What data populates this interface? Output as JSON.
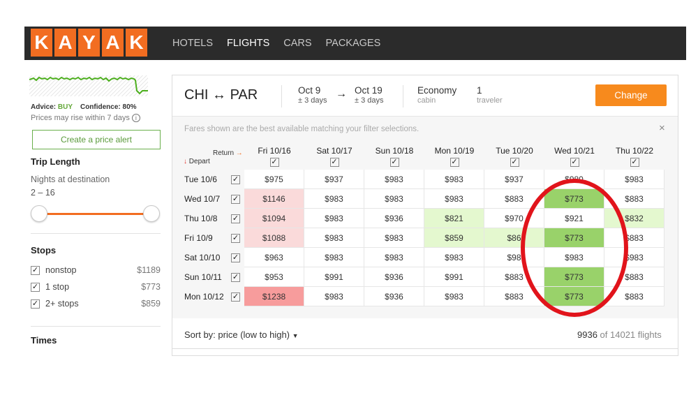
{
  "logo": [
    "K",
    "A",
    "Y",
    "A",
    "K"
  ],
  "nav": [
    {
      "label": "HOTELS",
      "active": false
    },
    {
      "label": "FLIGHTS",
      "active": true
    },
    {
      "label": "CARS",
      "active": false
    },
    {
      "label": "PACKAGES",
      "active": false
    }
  ],
  "sidebar": {
    "advice_label": "Advice:",
    "advice_value": "BUY",
    "confidence_label": "Confidence:",
    "confidence_value": "80%",
    "rise_text": "Prices may rise within 7 days",
    "alert_button": "Create a price alert",
    "trip_length_title": "Trip Length",
    "nights_label": "Nights at destination",
    "nights_range": "2 – 16",
    "stops_title": "Stops",
    "stops": [
      {
        "label": "nonstop",
        "price": "$1189",
        "checked": true
      },
      {
        "label": "1 stop",
        "price": "$773",
        "checked": true
      },
      {
        "label": "2+ stops",
        "price": "$859",
        "checked": true
      }
    ],
    "times_title": "Times"
  },
  "search": {
    "route_from": "CHI",
    "route_sym": "↔",
    "route_to": "PAR",
    "depart_date": "Oct 9",
    "depart_flex": "± 3 days",
    "return_date": "Oct 19",
    "return_flex": "± 3 days",
    "cabin": "Economy",
    "cabin_label": "cabin",
    "travelers": "1",
    "travelers_label": "traveler",
    "change_button": "Change"
  },
  "grid": {
    "notice": "Fares shown are the best available matching your filter selections.",
    "close": "×",
    "return_label": "Return",
    "depart_label": "Depart",
    "columns": [
      "Fri 10/16",
      "Sat 10/17",
      "Sun 10/18",
      "Mon 10/19",
      "Tue 10/20",
      "Wed 10/21",
      "Thu 10/22"
    ],
    "rows": [
      {
        "label": "Tue 10/6",
        "prices": [
          "$975",
          "$937",
          "$983",
          "$983",
          "$937",
          "$980",
          "$983"
        ],
        "shade": [
          "",
          "",
          "",
          "",
          "",
          "",
          ""
        ]
      },
      {
        "label": "Wed 10/7",
        "prices": [
          "$1146",
          "$983",
          "$983",
          "$983",
          "$883",
          "$773",
          "$883"
        ],
        "shade": [
          "lr",
          "",
          "",
          "",
          "",
          "g",
          ""
        ]
      },
      {
        "label": "Thu 10/8",
        "prices": [
          "$1094",
          "$983",
          "$936",
          "$821",
          "$970",
          "$921",
          "$832"
        ],
        "shade": [
          "lr",
          "",
          "",
          "lg",
          "",
          "",
          "lg"
        ]
      },
      {
        "label": "Fri 10/9",
        "prices": [
          "$1088",
          "$983",
          "$983",
          "$859",
          "$86",
          "$773",
          "$883"
        ],
        "shade": [
          "lr",
          "",
          "",
          "lg",
          "lg",
          "g",
          ""
        ]
      },
      {
        "label": "Sat 10/10",
        "prices": [
          "$963",
          "$983",
          "$983",
          "$983",
          "$98",
          "$983",
          "$983"
        ],
        "shade": [
          "",
          "",
          "",
          "",
          "",
          "",
          ""
        ]
      },
      {
        "label": "Sun 10/11",
        "prices": [
          "$953",
          "$991",
          "$936",
          "$991",
          "$883",
          "$773",
          "$883"
        ],
        "shade": [
          "",
          "",
          "",
          "",
          "",
          "g",
          ""
        ]
      },
      {
        "label": "Mon 10/12",
        "prices": [
          "$1238",
          "$983",
          "$936",
          "$983",
          "$883",
          "$773",
          "$883"
        ],
        "shade": [
          "r",
          "",
          "",
          "",
          "",
          "g",
          ""
        ]
      }
    ]
  },
  "results": {
    "sort_label": "Sort by: price (low to high)",
    "shown": "9936",
    "of": "of",
    "total": "14021 flights"
  },
  "colors": {
    "brand": "#f26d21",
    "cheap": "#99d26a",
    "expensive": "#f79c9c",
    "highlight_circle": "#e1141b"
  }
}
